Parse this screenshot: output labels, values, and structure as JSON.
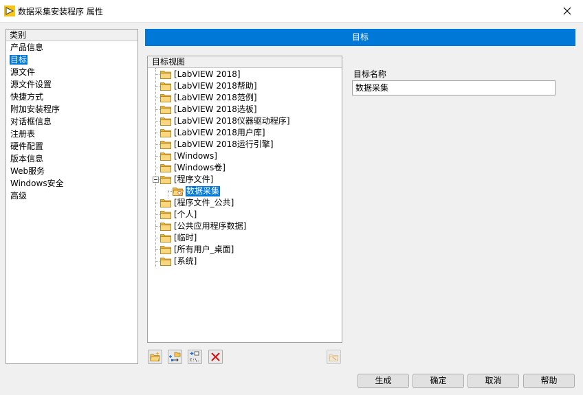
{
  "window": {
    "title": "数据采集安装程序 属性"
  },
  "categories": {
    "header": "类别",
    "items": [
      {
        "label": "产品信息"
      },
      {
        "label": "目标"
      },
      {
        "label": "源文件"
      },
      {
        "label": "源文件设置"
      },
      {
        "label": "快捷方式"
      },
      {
        "label": "附加安装程序"
      },
      {
        "label": "对话框信息"
      },
      {
        "label": "注册表"
      },
      {
        "label": "硬件配置"
      },
      {
        "label": "版本信息"
      },
      {
        "label": "Web服务"
      },
      {
        "label": "Windows安全"
      },
      {
        "label": "高级"
      }
    ],
    "selected": "目标"
  },
  "page": {
    "title": "目标"
  },
  "tree": {
    "header": "目标视图",
    "nodes": [
      {
        "label": "[LabVIEW 2018]"
      },
      {
        "label": "[LabVIEW 2018帮助]"
      },
      {
        "label": "[LabVIEW 2018范例]"
      },
      {
        "label": "[LabVIEW 2018选板]"
      },
      {
        "label": "[LabVIEW 2018仪器驱动程序]"
      },
      {
        "label": "[LabVIEW 2018用户库]"
      },
      {
        "label": "[LabVIEW 2018运行引擎]"
      },
      {
        "label": "[Windows]"
      },
      {
        "label": "[Windows卷]"
      },
      {
        "label": "[程序文件]"
      },
      {
        "label": "数据采集"
      },
      {
        "label": "[程序文件_公共]"
      },
      {
        "label": "[个人]"
      },
      {
        "label": "[公共应用程序数据]"
      },
      {
        "label": "[临时]"
      },
      {
        "label": "[所有用户_桌面]"
      },
      {
        "label": "[系统]"
      }
    ],
    "selected": "数据采集"
  },
  "toolbar": {
    "icons": [
      "new-folder-icon",
      "add-folder-icon",
      "add-path-icon",
      "delete-icon",
      "folder-properties-icon"
    ]
  },
  "target": {
    "name_label": "目标名称",
    "name_value": "数据采集"
  },
  "buttons": {
    "build": "生成",
    "ok": "确定",
    "cancel": "取消",
    "help": "帮助"
  },
  "colors": {
    "accent": "#0078d7",
    "folder": "#f2c45a",
    "delete": "#d01818"
  }
}
